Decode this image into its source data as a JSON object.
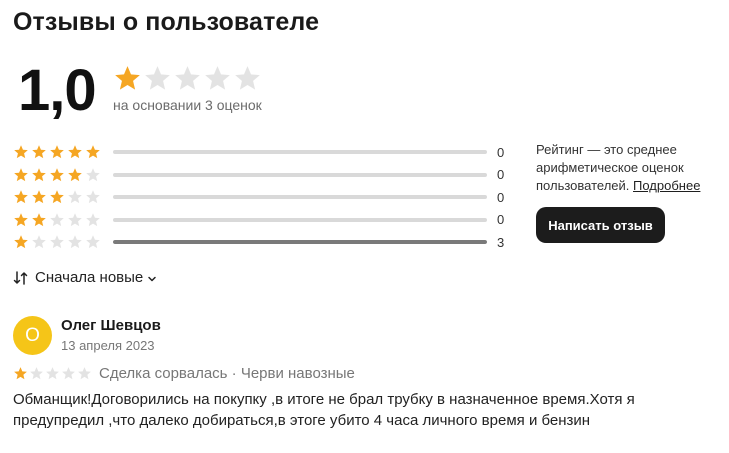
{
  "page": {
    "title": "Отзывы о пользователе"
  },
  "summary": {
    "rating": "1,0",
    "stars_filled": 1,
    "stars_total": 5,
    "based_on": "на основании 3 оценок"
  },
  "distribution": [
    {
      "stars": 5,
      "count": "0",
      "fraction": 0
    },
    {
      "stars": 4,
      "count": "0",
      "fraction": 0
    },
    {
      "stars": 3,
      "count": "0",
      "fraction": 0
    },
    {
      "stars": 2,
      "count": "0",
      "fraction": 0
    },
    {
      "stars": 1,
      "count": "3",
      "fraction": 1
    }
  ],
  "info": {
    "text": "Рейтинг — это среднее арифметическое оценок пользователей.",
    "link": "Подробнее"
  },
  "write_button": "Написать отзыв",
  "sort": {
    "label": "Сначала новые"
  },
  "review": {
    "avatar_letter": "О",
    "author": "Олег Шевцов",
    "date": "13 апреля 2023",
    "stars_filled": 1,
    "tags": "Сделка сорвалась · Черви навозные",
    "text": "Обманщик!Договорились на покупку ,в итоге не брал трубку в назначенное время.Хотя я предупредил ,что далеко добираться,в этоге убито 4 часа личного время и бензин"
  },
  "colors": {
    "star_on": "#f5a623",
    "star_off": "#e3e3e3",
    "button_bg": "#1c1c1c",
    "avatar_bg": "#f5c518"
  }
}
